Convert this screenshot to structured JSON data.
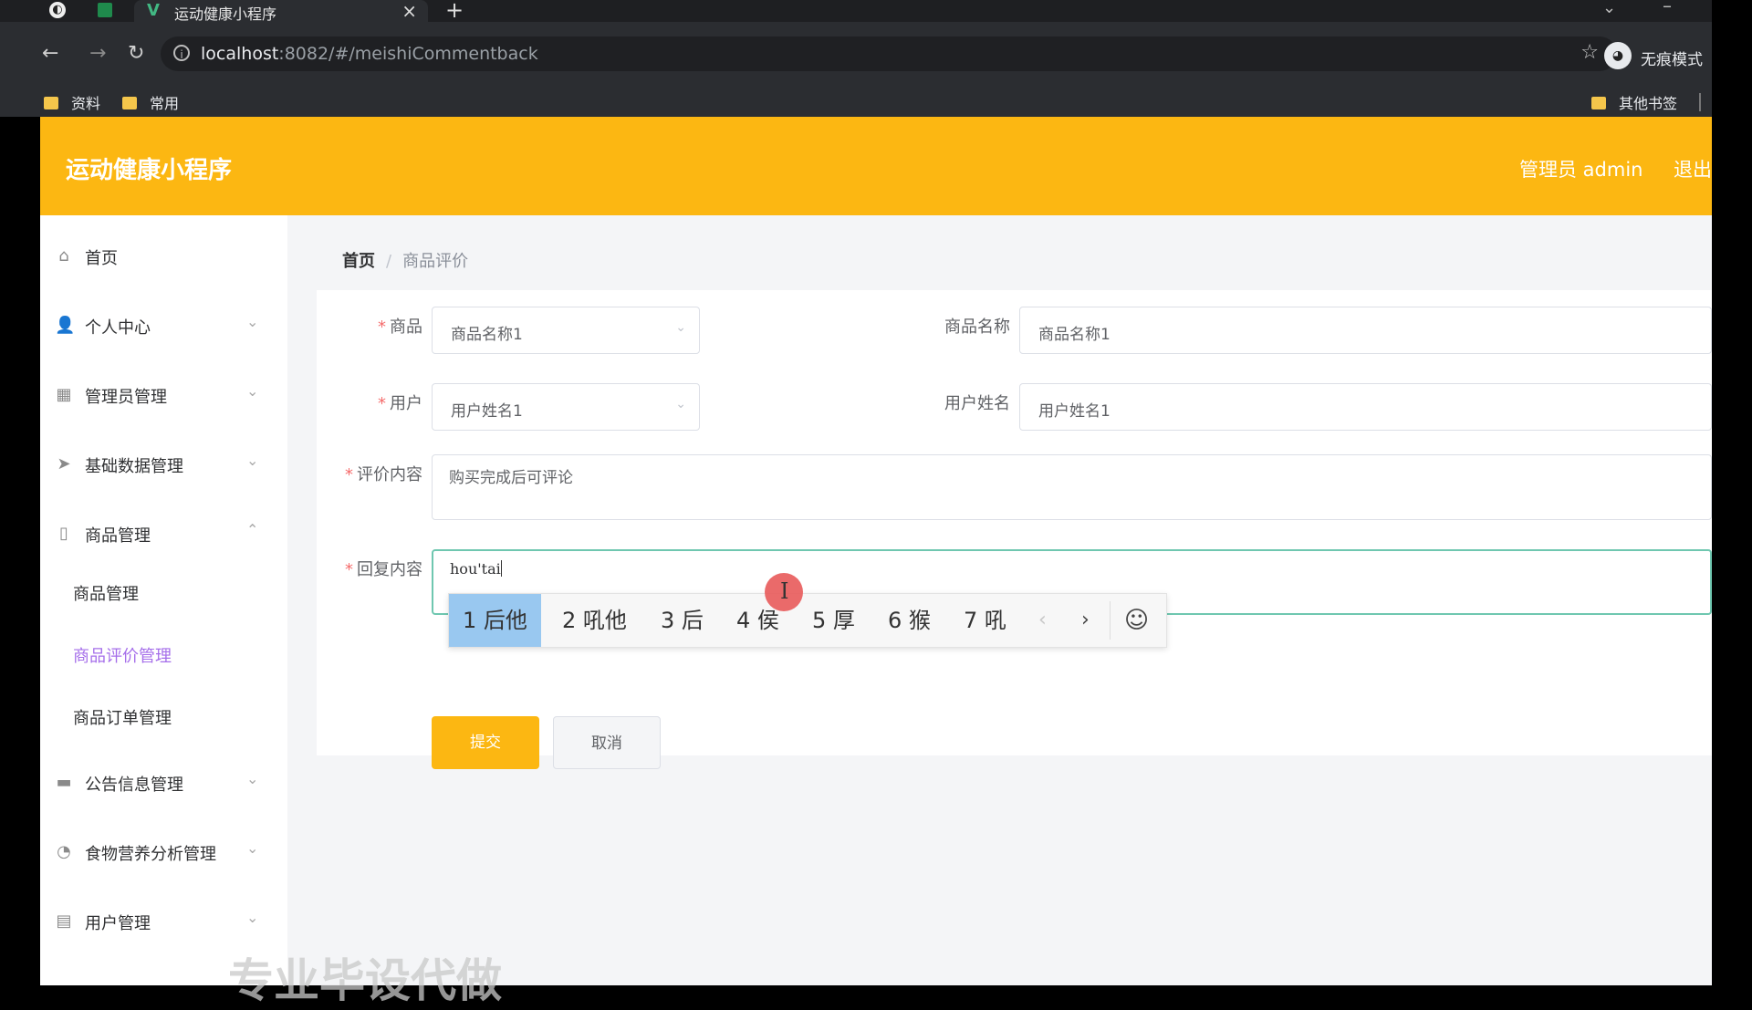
{
  "browser": {
    "tab_title": "运动健康小程序",
    "url_host": "localhost",
    "url_rest": ":8082/#/meishiCommentback",
    "incognito_label": "无痕模式",
    "bookmarks": [
      "资料",
      "常用"
    ],
    "other_bookmarks": "其他书签"
  },
  "app": {
    "title": "运动健康小程序",
    "user_label": "管理员 admin",
    "logout_label": "退出"
  },
  "sidebar": {
    "items": [
      {
        "label": "首页",
        "icon": "home-icon"
      },
      {
        "label": "个人中心",
        "icon": "user-icon"
      },
      {
        "label": "管理员管理",
        "icon": "grid-icon"
      },
      {
        "label": "基础数据管理",
        "icon": "send-icon"
      },
      {
        "label": "商品管理",
        "icon": "phone-icon"
      },
      {
        "label": "公告信息管理",
        "icon": "briefcase-icon"
      },
      {
        "label": "食物营养分析管理",
        "icon": "gauge-icon"
      },
      {
        "label": "用户管理",
        "icon": "chat-icon"
      }
    ],
    "sub_items": [
      "商品管理",
      "商品评价管理",
      "商品订单管理"
    ],
    "active_sub": "商品评价管理"
  },
  "breadcrumb": {
    "home": "首页",
    "current": "商品评价"
  },
  "form": {
    "goods_label": "商品",
    "goods_value": "商品名称1",
    "goods_name_label": "商品名称",
    "goods_name_value": "商品名称1",
    "user_label": "用户",
    "user_value": "用户姓名1",
    "user_name_label": "用户姓名",
    "user_name_value": "用户姓名1",
    "comment_label": "评价内容",
    "comment_value": "购买完成后可评论",
    "reply_label": "回复内容",
    "reply_value": "hou'tai",
    "submit_label": "提交",
    "cancel_label": "取消"
  },
  "ime": {
    "candidates": [
      "1 后他",
      "2 吼他",
      "3 后",
      "4 侯",
      "5 厚",
      "6 猴",
      "7 吼"
    ],
    "selected_index": 0
  },
  "overlay_text": "专业毕设代做",
  "colors": {
    "header": "#fcb712",
    "accent_purple": "#a56eea",
    "submit": "#fcb712",
    "required": "#f56c6c"
  }
}
